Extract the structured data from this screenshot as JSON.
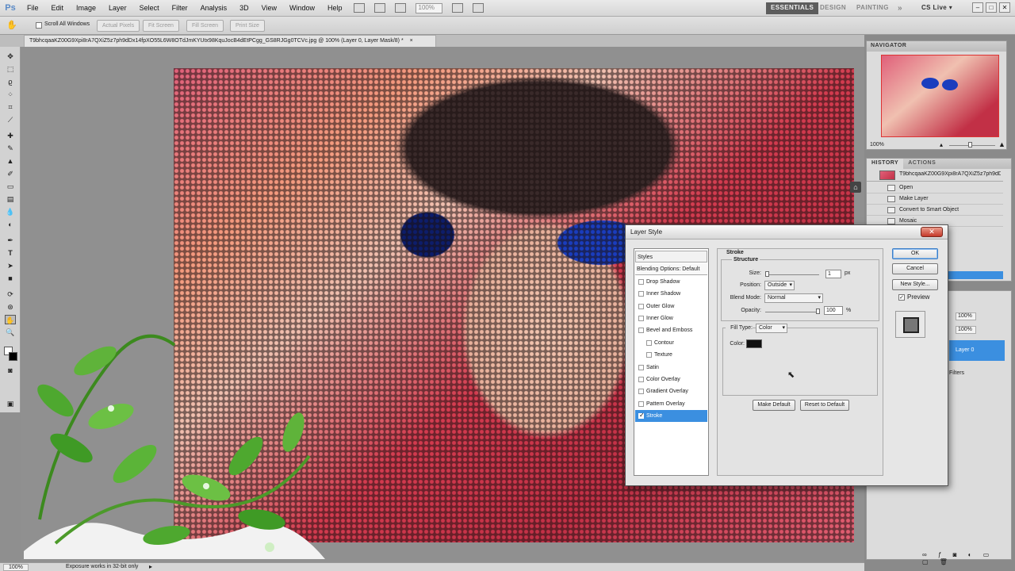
{
  "app": {
    "logo": "Ps"
  },
  "menu": [
    "File",
    "Edit",
    "Image",
    "Layer",
    "Select",
    "Filter",
    "Analysis",
    "3D",
    "View",
    "Window",
    "Help"
  ],
  "menubar": {
    "zoom": "100%",
    "workspaces": [
      "ESSENTIALS",
      "DESIGN",
      "PAINTING"
    ],
    "more": "»",
    "cs_live": "CS Live ▾"
  },
  "options": {
    "scroll_all_windows": "Scroll All Windows",
    "buttons": [
      "Actual Pixels",
      "Fit Screen",
      "Fill Screen",
      "Print Size"
    ]
  },
  "document": {
    "tab_title": "T9bhcqaaKZ00G9Xpi8rA7QXiZ5z7ph9dDx14fpXO55L6W8OTdJmKYUtx98KquJocB4dEtPCgg_GS8RJGg0TCVc.jpg @ 100% (Layer 0, Layer Mask/8) *",
    "tab_close": "×"
  },
  "status": {
    "zoom": "100%",
    "message": "Exposure works in 32-bit only"
  },
  "navigator": {
    "title": "NAVIGATOR",
    "zoom": "100%"
  },
  "history": {
    "tabs": [
      "HISTORY",
      "ACTIONS"
    ],
    "snapshot_name": "T9bhcqaaKZ00G9Xpi8rA7QXiZ5z7ph9dDx14fpX",
    "states": [
      "Open",
      "Make Layer",
      "Convert to Smart Object",
      "Mosaic"
    ]
  },
  "layers": {
    "opacity": "100%",
    "fill": "100%",
    "layer_name": "Layer 0",
    "filters_label": "Filters"
  },
  "dialog": {
    "title": "Layer Style",
    "close": "✕",
    "styles": [
      {
        "label": "Styles",
        "kind": "header"
      },
      {
        "label": "Blending Options: Default",
        "kind": "bo"
      },
      {
        "label": "Drop Shadow",
        "kind": "cb"
      },
      {
        "label": "Inner Shadow",
        "kind": "cb"
      },
      {
        "label": "Outer Glow",
        "kind": "cb"
      },
      {
        "label": "Inner Glow",
        "kind": "cb"
      },
      {
        "label": "Bevel and Emboss",
        "kind": "cb"
      },
      {
        "label": "Contour",
        "kind": "sub"
      },
      {
        "label": "Texture",
        "kind": "sub"
      },
      {
        "label": "Satin",
        "kind": "cb"
      },
      {
        "label": "Color Overlay",
        "kind": "cb"
      },
      {
        "label": "Gradient Overlay",
        "kind": "cb"
      },
      {
        "label": "Pattern Overlay",
        "kind": "cb"
      },
      {
        "label": "Stroke",
        "kind": "selected"
      }
    ],
    "stroke": {
      "heading": "Stroke",
      "structure": "Structure",
      "size_label": "Size:",
      "size_value": "1",
      "size_unit": "px",
      "position_label": "Position:",
      "position_value": "Outside",
      "blend_label": "Blend Mode:",
      "blend_value": "Normal",
      "opacity_label": "Opacity:",
      "opacity_value": "100",
      "opacity_unit": "%",
      "fill_type_label": "Fill Type:",
      "fill_type_value": "Color",
      "color_label": "Color:"
    },
    "buttons": {
      "make_default": "Make Default",
      "reset_default": "Reset to Default",
      "ok": "OK",
      "cancel": "Cancel",
      "new_style": "New Style...",
      "preview": "Preview"
    }
  },
  "colors": {
    "selection": "#3b8fe0",
    "stroke_color": "#111111",
    "close_button": "#c5392a"
  }
}
